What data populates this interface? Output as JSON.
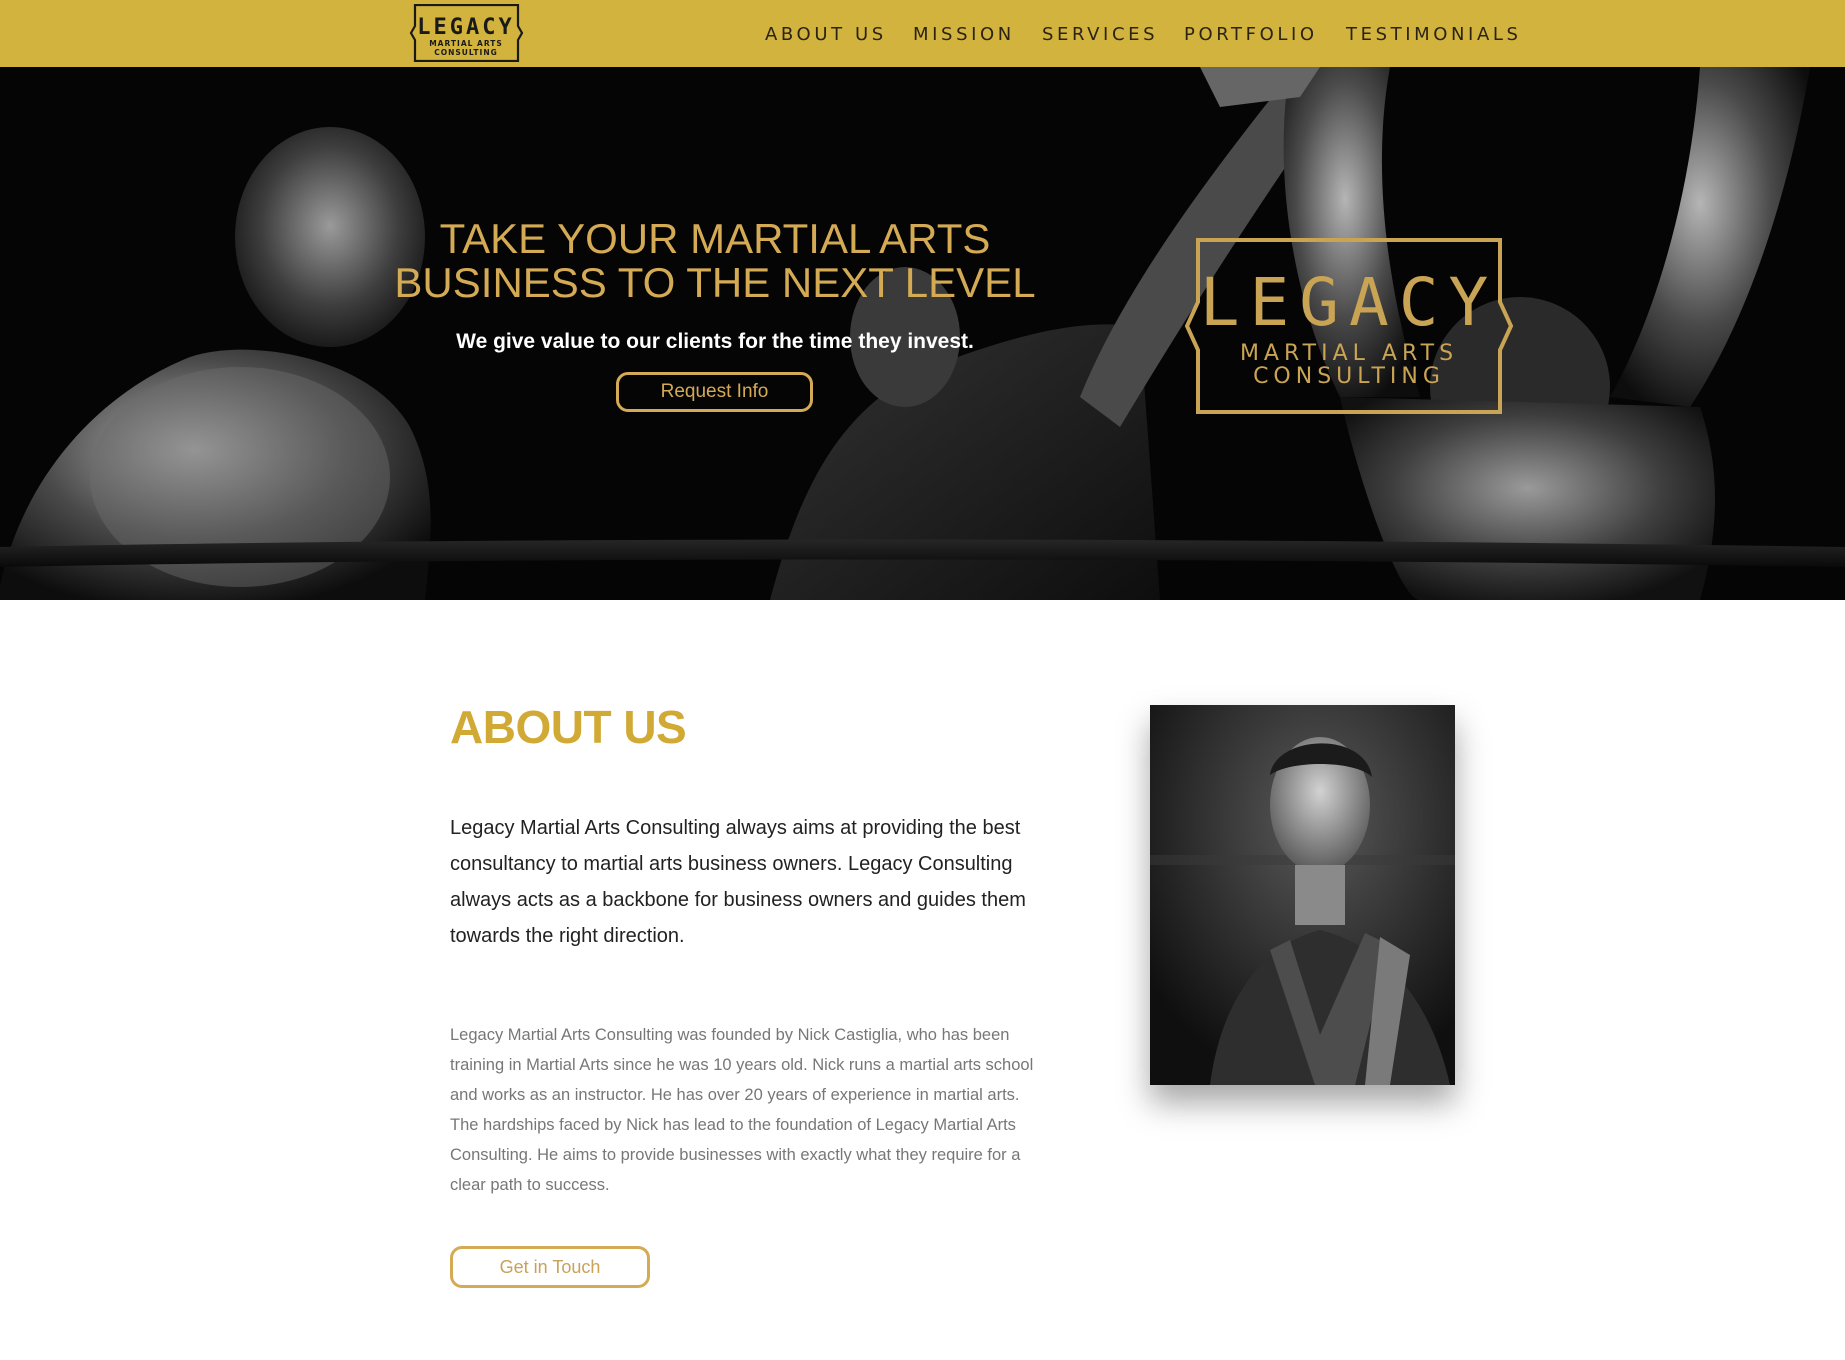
{
  "brand": {
    "logo_word": "LEGACY",
    "logo_line1": "MARTIAL ARTS",
    "logo_line2": "CONSULTING",
    "gold": "#d1b33d",
    "accent": "#d4aa55"
  },
  "nav": {
    "items": [
      {
        "label": "ABOUT US"
      },
      {
        "label": "MISSION"
      },
      {
        "label": "SERVICES"
      },
      {
        "label": "PORTFOLIO"
      },
      {
        "label": "TESTIMONIALS"
      }
    ]
  },
  "hero": {
    "title_line1": "TAKE YOUR MARTIAL ARTS",
    "title_line2": "BUSINESS TO THE NEXT LEVEL",
    "subtitle": "We give value to our clients for the time they invest.",
    "button_label": "Request Info",
    "logo_word": "LEGACY",
    "logo_line1": "MARTIAL ARTS",
    "logo_line2": "CONSULTING"
  },
  "about": {
    "title": "ABOUT US",
    "lead": "Legacy Martial Arts Consulting always aims at providing the best consultancy to martial arts business owners. Legacy Consulting always acts as a backbone for business owners and guides them towards the right direction.",
    "body": "Legacy Martial Arts Consulting was founded by Nick Castiglia, who has been training in Martial Arts since he was 10 years old. Nick runs a martial arts school and works as an instructor. He has over 20 years of experience in martial arts. The hardships faced by Nick has lead to the foundation of Legacy Martial Arts Consulting. He aims to provide businesses with exactly what they require for a clear path to success.",
    "button_label": "Get in Touch"
  }
}
